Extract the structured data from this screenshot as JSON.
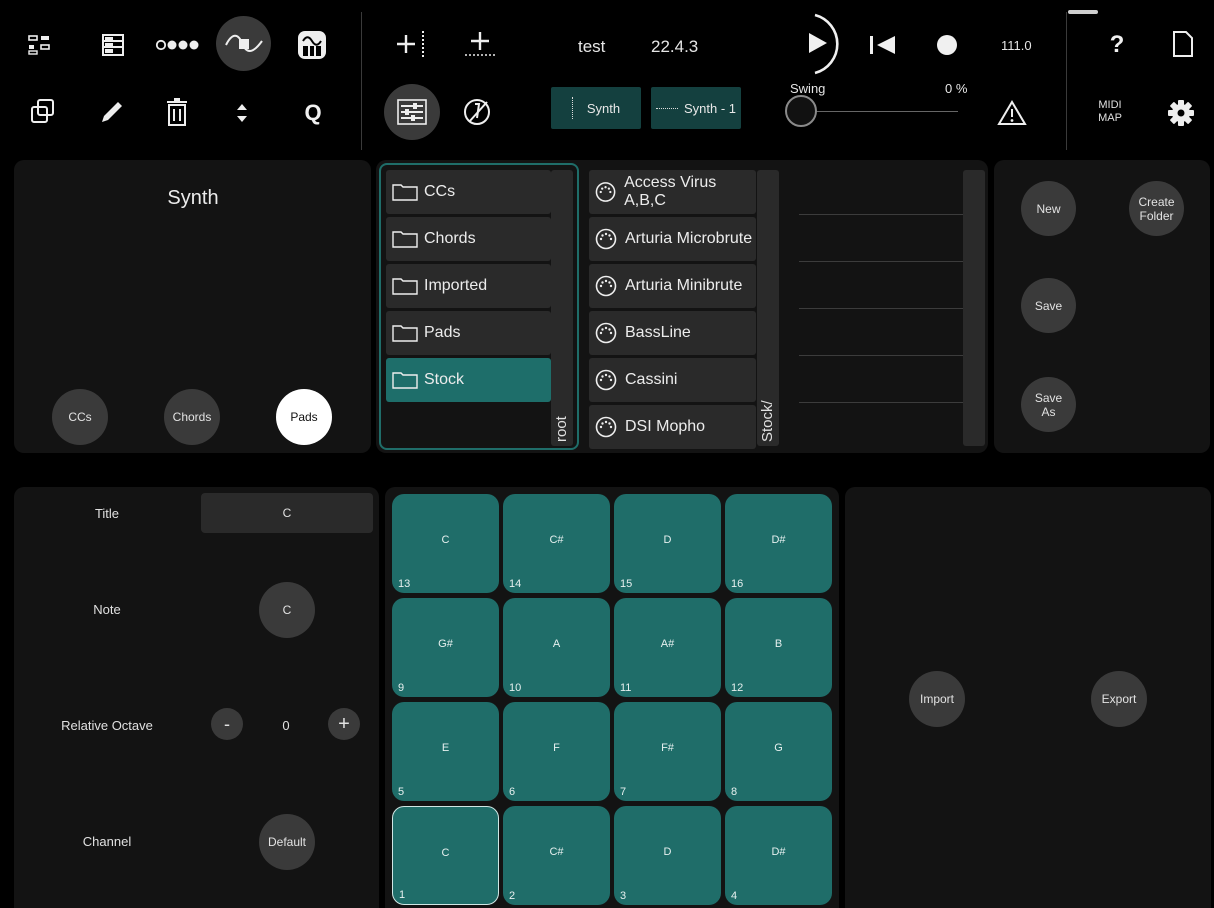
{
  "toolbar": {
    "project_name": "test",
    "version": "22.4.3",
    "tempo": "111.0",
    "swing_label": "Swing",
    "swing_value": "0 %",
    "quantize_label": "Q",
    "help_label": "?",
    "midi_map_line1": "MIDI",
    "midi_map_line2": "MAP",
    "track_chip": "Synth",
    "clip_chip": "Synth - 1"
  },
  "synth_panel": {
    "title": "Synth",
    "modes": [
      "CCs",
      "Chords",
      "Pads"
    ],
    "selected_mode": "Pads"
  },
  "browser": {
    "folders": [
      "CCs",
      "Chords",
      "Imported",
      "Pads",
      "Stock"
    ],
    "selected_folder": "Stock",
    "folder_path_label": "root",
    "devices": [
      "Access Virus A,B,C",
      "Arturia Microbrute",
      "Arturia Minibrute",
      "BassLine",
      "Cassini",
      "DSI Mopho"
    ],
    "device_path_label": "Stock/"
  },
  "actions": {
    "new": "New",
    "create_folder_line1": "Create",
    "create_folder_line2": "Folder",
    "save": "Save",
    "save_as_line1": "Save",
    "save_as_line2": "As"
  },
  "pad_props": {
    "title_label": "Title",
    "title_value": "C",
    "note_label": "Note",
    "note_value": "C",
    "octave_label": "Relative Octave",
    "octave_minus": "-",
    "octave_value": "0",
    "octave_plus": "+",
    "channel_label": "Channel",
    "channel_value": "Default"
  },
  "pads": [
    {
      "note": "C",
      "index": "13"
    },
    {
      "note": "C#",
      "index": "14"
    },
    {
      "note": "D",
      "index": "15"
    },
    {
      "note": "D#",
      "index": "16"
    },
    {
      "note": "G#",
      "index": "9"
    },
    {
      "note": "A",
      "index": "10"
    },
    {
      "note": "A#",
      "index": "11"
    },
    {
      "note": "B",
      "index": "12"
    },
    {
      "note": "E",
      "index": "5"
    },
    {
      "note": "F",
      "index": "6"
    },
    {
      "note": "F#",
      "index": "7"
    },
    {
      "note": "G",
      "index": "8"
    },
    {
      "note": "C",
      "index": "1"
    },
    {
      "note": "C#",
      "index": "2"
    },
    {
      "note": "D",
      "index": "3"
    },
    {
      "note": "D#",
      "index": "4"
    }
  ],
  "selected_pad_index": "1",
  "io": {
    "import": "Import",
    "export": "Export"
  },
  "colors": {
    "accent_teal": "#1f6d69",
    "chip_teal": "#14403f",
    "panel_bg": "#131313",
    "button_gray": "#3a3a3a"
  }
}
